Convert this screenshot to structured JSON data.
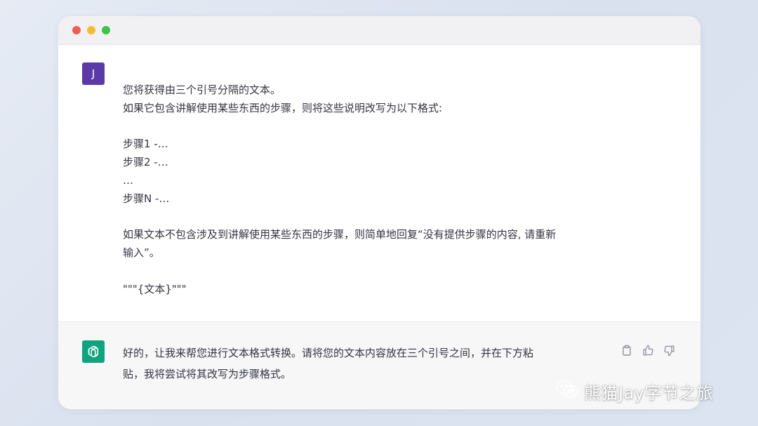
{
  "user": {
    "avatar_letter": "J",
    "lines": [
      "您将获得由三个引号分隔的文本。",
      "如果它包含讲解使用某些东西的步骤，则将这些说明改写为以下格式:",
      "",
      "步骤1 -…",
      "步骤2 -…",
      "…",
      "步骤N -…",
      "",
      "如果文本不包含涉及到讲解使用某些东西的步骤，则简单地回复“没有提供步骤的内容, 请重新",
      "输入”。",
      "",
      "\"\"\"{文本}\"\"\""
    ]
  },
  "assistant": {
    "avatar_icon": "openai-logo-icon",
    "lines": [
      "好的，让我来帮您进行文本格式转换。请将您的文本内容放在三个引号之间，并在下方粘",
      "贴，我将尝试将其改写为步骤格式。"
    ],
    "actions": [
      "copy-icon",
      "thumbs-up-icon",
      "thumbs-down-icon"
    ]
  },
  "watermark": {
    "text": "熊猫Jay字节之旅"
  },
  "colors": {
    "user_avatar": "#5b3aa8",
    "gpt_avatar": "#10a37f",
    "text": "#343541",
    "assistant_bg": "#f7f7f8"
  }
}
